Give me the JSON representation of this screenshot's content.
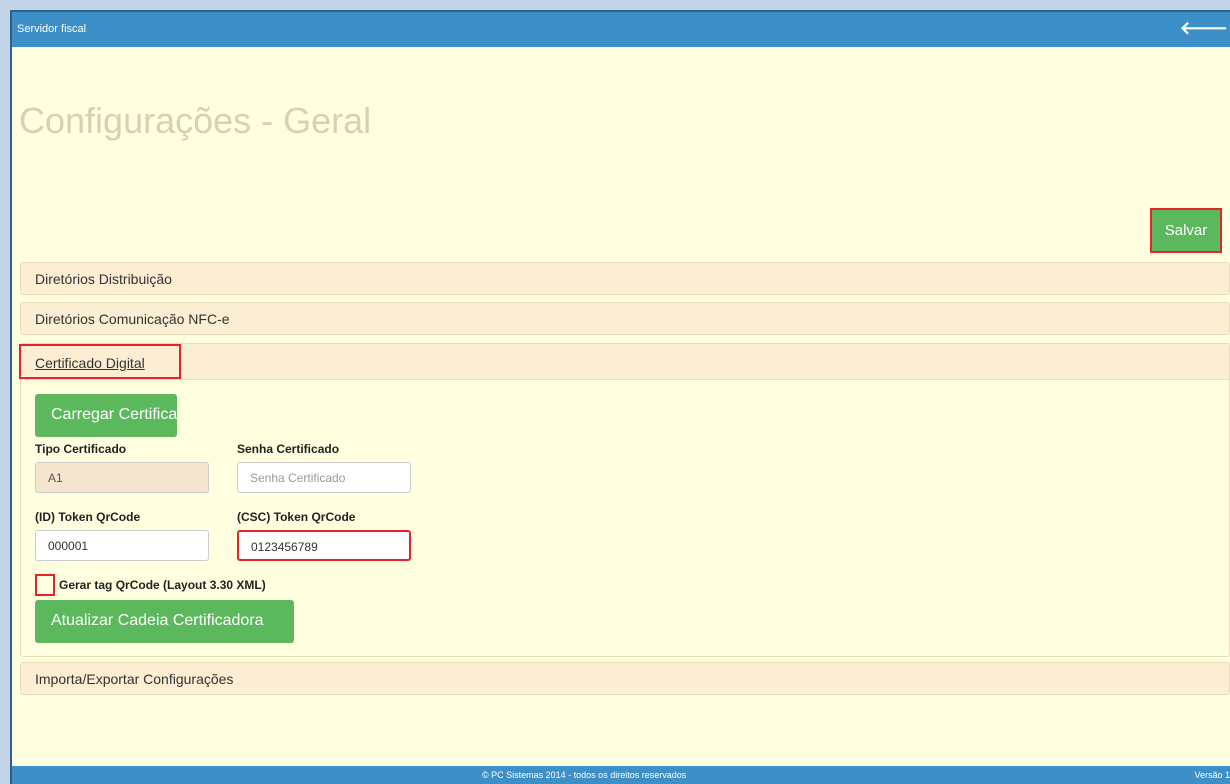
{
  "topbar": {
    "title": "Servidor fiscal",
    "back_icon": "arrow-left-icon",
    "back_glyph": "🡐"
  },
  "page": {
    "title": "Configurações - Geral"
  },
  "toolbar": {
    "save_label": "Salvar"
  },
  "panels": [
    {
      "label": "Diretórios Distribuição"
    },
    {
      "label": "Diretórios Comunicação NFC-e"
    },
    {
      "label": "Certificado Digital"
    },
    {
      "label": "Importa/Exportar Configurações"
    }
  ],
  "cert": {
    "load_button": "Carregar Certifica",
    "type_label": "Tipo Certificado",
    "type_value": "A1",
    "password_label": "Senha Certificado",
    "password_placeholder": "Senha Certificado",
    "token_id_label": "(ID) Token QrCode",
    "token_id_value": "000001",
    "token_csc_label": "(CSC) Token QrCode",
    "token_csc_value": "0123456789",
    "qrcode_checkbox_label": "Gerar tag QrCode (Layout 3.30 XML)",
    "qrcode_checked": false,
    "update_chain_button": "Atualizar Cadeia Certificadora"
  },
  "footer": {
    "copyright": "© PC Sistemas 2014 - todos os direitos reservados",
    "version": "Versão 1"
  },
  "colors": {
    "topbar": "#3d8fc7",
    "background": "#ffffe0",
    "button": "#5cb85c",
    "highlight": "#e8222a"
  }
}
